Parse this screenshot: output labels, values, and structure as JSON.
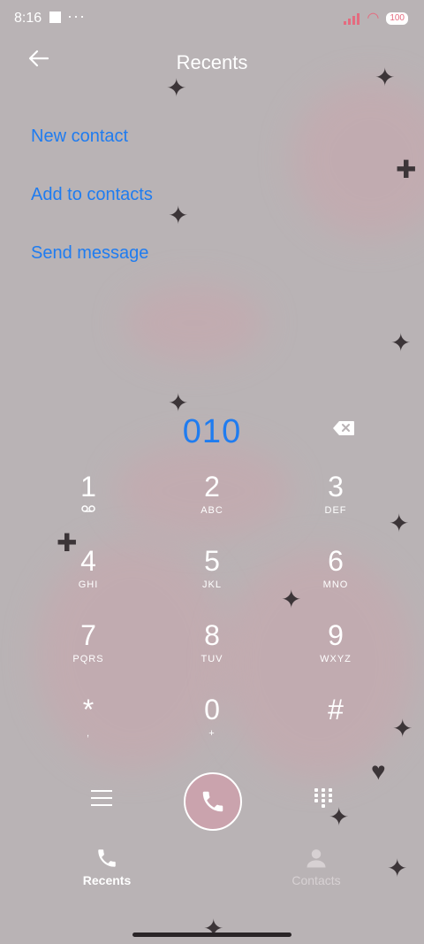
{
  "status_bar": {
    "time": "8:16",
    "dots": "···",
    "battery": "100"
  },
  "header": {
    "title": "Recents",
    "back_icon": "arrow-left-icon"
  },
  "actions": [
    {
      "label": "New contact"
    },
    {
      "label": "Add to contacts"
    },
    {
      "label": "Send message"
    }
  ],
  "dialer": {
    "number": "010",
    "keys": [
      {
        "digit": "1",
        "sub": ""
      },
      {
        "digit": "2",
        "sub": "ABC"
      },
      {
        "digit": "3",
        "sub": "DEF"
      },
      {
        "digit": "4",
        "sub": "GHI"
      },
      {
        "digit": "5",
        "sub": "JKL"
      },
      {
        "digit": "6",
        "sub": "MNO"
      },
      {
        "digit": "7",
        "sub": "PQRS"
      },
      {
        "digit": "8",
        "sub": "TUV"
      },
      {
        "digit": "9",
        "sub": "WXYZ"
      },
      {
        "digit": "*",
        "sub": ","
      },
      {
        "digit": "0",
        "sub": "+"
      },
      {
        "digit": "#",
        "sub": ""
      }
    ]
  },
  "tabs": [
    {
      "label": "Recents",
      "icon": "phone-icon",
      "active": true
    },
    {
      "label": "Contacts",
      "icon": "person-icon",
      "active": false
    }
  ],
  "colors": {
    "accent": "#1f7cf0",
    "background": "#b9b3b5",
    "call_button": "#caa3ad",
    "signal": "#e46b7f"
  }
}
